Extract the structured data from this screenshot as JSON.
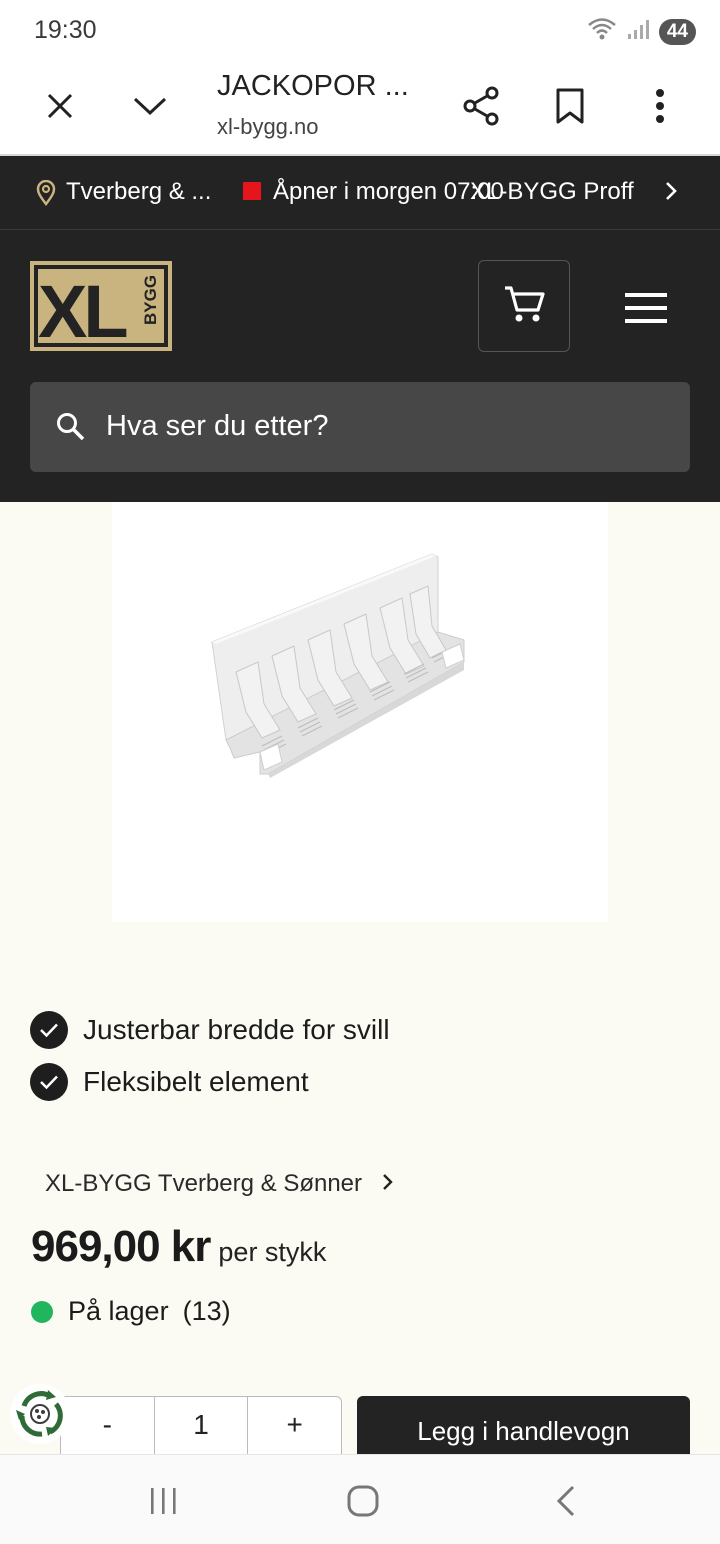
{
  "status_bar": {
    "time": "19:30",
    "battery": "44"
  },
  "browser": {
    "title": "JACKOPOR ...",
    "url": "xl-bygg.no"
  },
  "store_bar": {
    "store_name": "Tverberg & ...",
    "opening_text": "Åpner i morgen 07:00",
    "proff_text": "XL-BYGG Proff",
    "status_color": "#e6141c"
  },
  "header": {
    "logo_text": "XL",
    "logo_subtext": "BYGG",
    "search_placeholder": "Hva ser du etter?",
    "brand_gold": "#c9b37e",
    "background": "#232323"
  },
  "product": {
    "features": [
      "Justerbar bredde for svill",
      "Fleksibelt element"
    ],
    "store_link": "XL-BYGG Tverberg & Sønner",
    "price": "969,00 kr",
    "price_unit": "per stykk",
    "stock_label": "På lager",
    "stock_count": "(13)",
    "stock_color": "#1fb65d"
  },
  "cart": {
    "minus": "-",
    "quantity": "1",
    "plus": "+",
    "add_label": "Legg i handlevogn"
  },
  "icons": [
    "close-icon",
    "chevron-down-icon",
    "share-icon",
    "bookmark-icon",
    "more-vert-icon",
    "location-pin-icon",
    "chevron-right-icon",
    "cart-icon",
    "hamburger-menu-icon",
    "search-icon",
    "check-icon",
    "recycle-icon",
    "recent-apps-icon",
    "home-icon",
    "back-icon"
  ]
}
